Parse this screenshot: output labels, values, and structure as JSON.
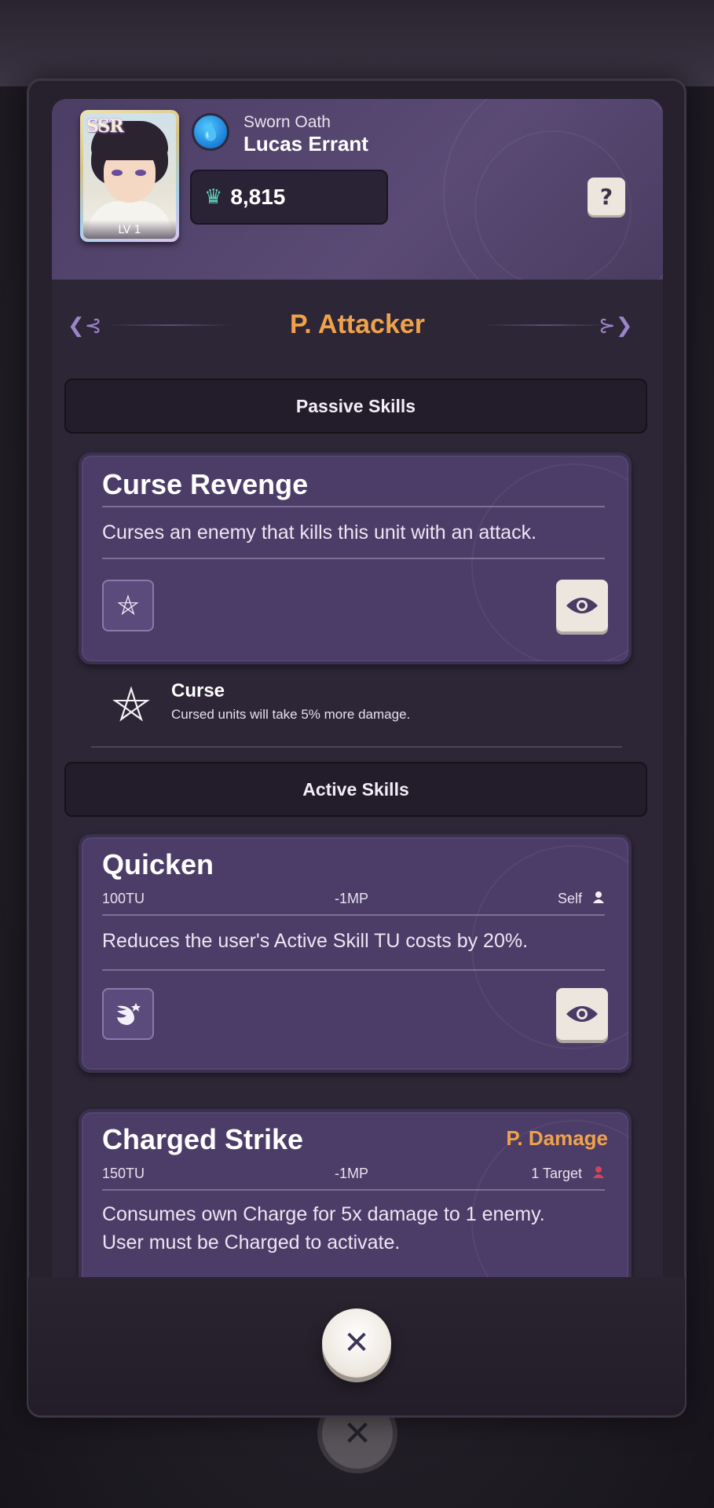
{
  "character": {
    "rarity": "SSR",
    "level": "LV 1",
    "subtitle": "Sworn Oath",
    "name": "Lucas Errant",
    "power": "8,815",
    "element_icon": "water-drop-icon",
    "help_label": "?"
  },
  "role": {
    "title": "P. Attacker"
  },
  "sections": {
    "passive": "Passive Skills",
    "active": "Active Skills"
  },
  "passive_skill": {
    "name": "Curse Revenge",
    "description": "Curses an enemy that kills this unit with an attack.",
    "icon": "pentagram-icon"
  },
  "status_effect": {
    "name": "Curse",
    "description": "Cursed units will take 5% more damage.",
    "icon": "pentagram-icon"
  },
  "active_skills": [
    {
      "name": "Quicken",
      "tu": "100TU",
      "mp": "-1MP",
      "target": "Self",
      "target_icon": "person-icon",
      "description": "Reduces the user's Active Skill TU costs by 20%.",
      "icon": "wing-icon",
      "type": ""
    },
    {
      "name": "Charged Strike",
      "tu": "150TU",
      "mp": "-1MP",
      "target": "1 Target",
      "target_icon": "person-icon",
      "description_line1": "Consumes own Charge for 5x damage to 1 enemy.",
      "description_line2": "User must be Charged to activate.",
      "type": "P. Damage"
    }
  ],
  "colors": {
    "accent_orange": "#f0a24a",
    "card_purple": "#4b3d68",
    "panel_dark": "#2c2636",
    "target_red": "#d0455a"
  },
  "close_label": "✕"
}
